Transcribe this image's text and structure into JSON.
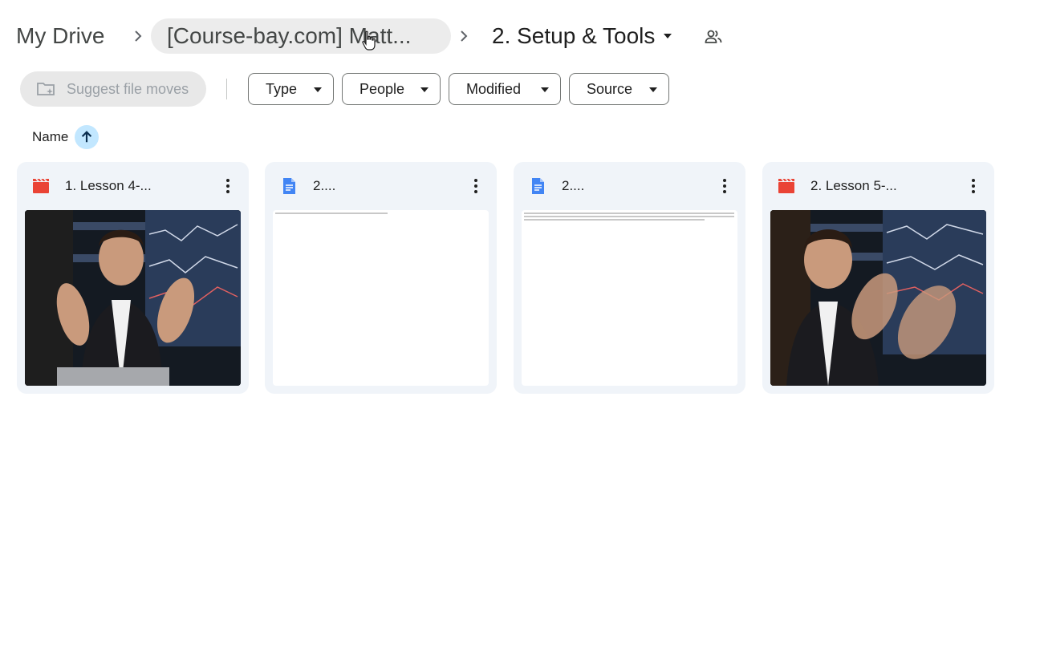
{
  "breadcrumb": {
    "root": "My Drive",
    "middle": "[Course-bay.com] Matt...",
    "current": "2. Setup & Tools"
  },
  "toolbar": {
    "suggest_label": "Suggest file moves",
    "filters": [
      "Type",
      "People",
      "Modified",
      "Source"
    ]
  },
  "sort": {
    "label": "Name",
    "direction": "ascending"
  },
  "files": [
    {
      "name": "1. Lesson 4-...",
      "type": "video",
      "icon": "video-file-icon"
    },
    {
      "name": "2....",
      "type": "document",
      "icon": "docs-file-icon"
    },
    {
      "name": "2....",
      "type": "document",
      "icon": "docs-file-icon"
    },
    {
      "name": "2. Lesson 5-...",
      "type": "video",
      "icon": "video-file-icon"
    }
  ],
  "colors": {
    "video_icon": "#ea4335",
    "doc_icon": "#4285f4",
    "card_bg": "#f0f4f9",
    "sort_accent": "#c2e7ff"
  }
}
